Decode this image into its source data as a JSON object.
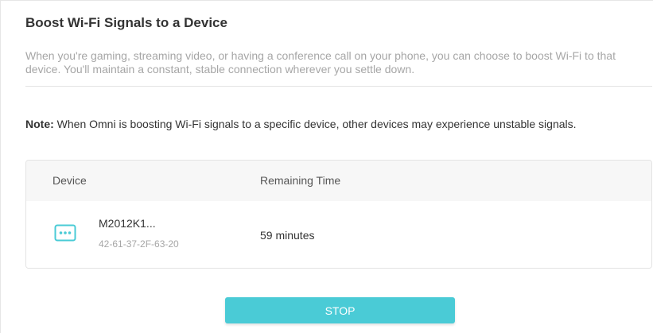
{
  "section": {
    "title": "Boost Wi-Fi Signals to a Device",
    "description": "When you're gaming, streaming video, or having a conference call on your phone, you can choose to boost Wi-Fi to that device. You'll maintain a constant, stable connection wherever you settle down.",
    "note_label": "Note:",
    "note_text": " When Omni is boosting Wi-Fi signals to a specific device, other devices may experience unstable signals."
  },
  "table": {
    "headers": {
      "device": "Device",
      "remaining_time": "Remaining Time"
    },
    "rows": [
      {
        "device_name": "M2012K1...",
        "mac": "42-61-37-2F-63-20",
        "remaining_time": "59 minutes",
        "icon": "device-generic-icon"
      }
    ]
  },
  "actions": {
    "stop_label": "STOP"
  },
  "colors": {
    "accent": "#4acbd6",
    "icon": "#4acbd6",
    "muted_text": "#a6a6a6"
  }
}
